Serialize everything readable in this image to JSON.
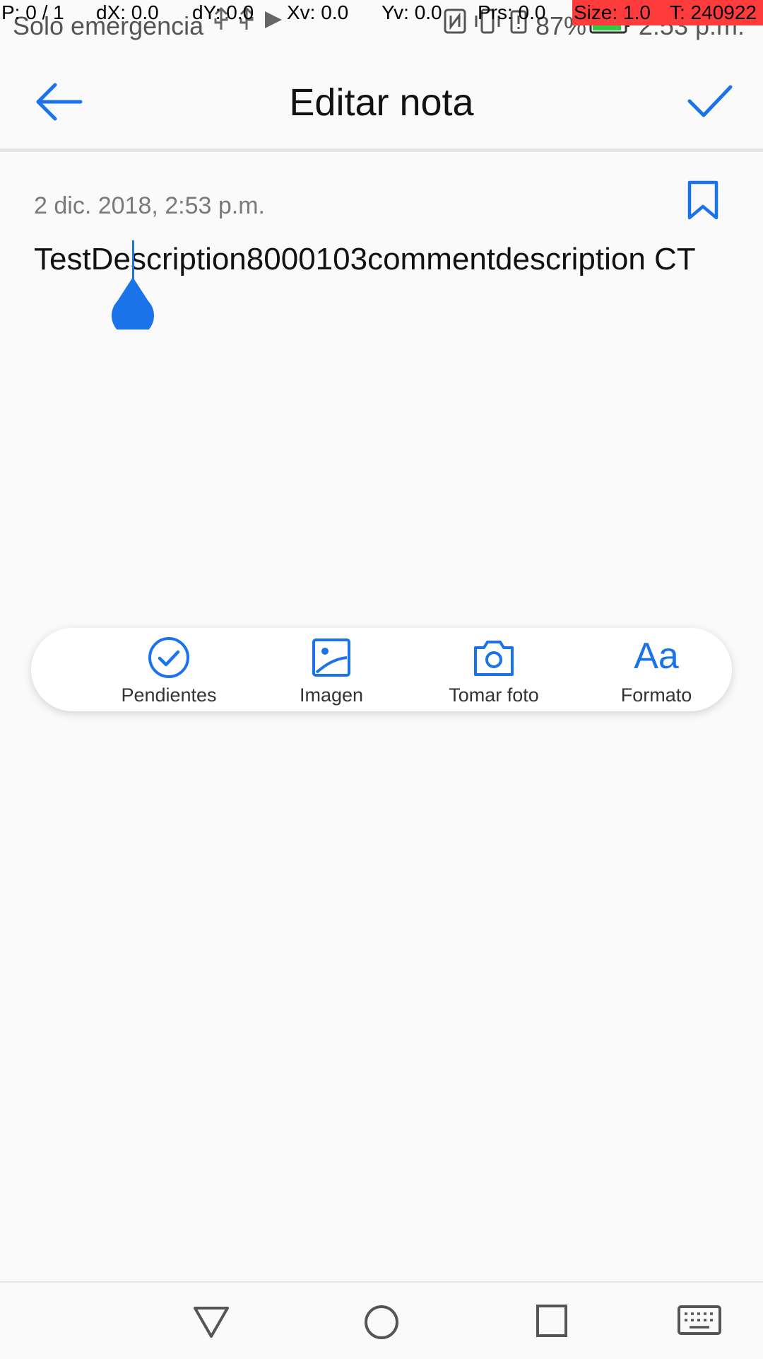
{
  "status_bar": {
    "carrier": "Solo emergencia",
    "battery": "87%",
    "time": "2:53 p.m."
  },
  "debug_overlay": {
    "p": "P: 0 / 1",
    "dx": "dX: 0.0",
    "dy": "dY: 0.0",
    "xv": "Xv: 0.0",
    "yv": "Yv: 0.0",
    "prs": "Prs: 0.0",
    "size": "Size: 1.0",
    "t": "T: 240922"
  },
  "header": {
    "title": "Editar nota"
  },
  "note": {
    "date": "2 dic. 2018, 2:53 p.m.",
    "text": "TestDescription8000103commentdescription CT"
  },
  "toolbar": {
    "items": [
      {
        "label": "Pendientes",
        "icon": "checkmark-circle-icon"
      },
      {
        "label": "Imagen",
        "icon": "image-icon"
      },
      {
        "label": "Tomar foto",
        "icon": "camera-icon"
      },
      {
        "label": "Formato",
        "icon": "text-format-icon",
        "glyph": "Aa"
      }
    ]
  },
  "colors": {
    "accent": "#1a73e8",
    "background": "#fafafa"
  }
}
